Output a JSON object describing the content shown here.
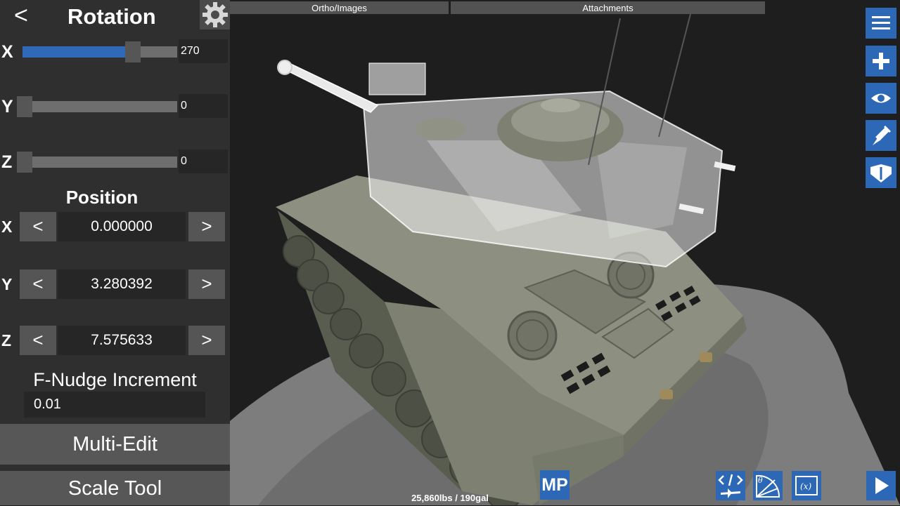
{
  "rotation_panel": {
    "back_label": "<",
    "title": "Rotation",
    "rows": [
      {
        "axis": "X",
        "value": "270",
        "fraction": 0.72
      },
      {
        "axis": "Y",
        "value": "0",
        "fraction": 0
      },
      {
        "axis": "Z",
        "value": "0",
        "fraction": 0
      }
    ]
  },
  "position_panel": {
    "title": "Position",
    "decrement_label": "<",
    "increment_label": ">",
    "rows": [
      {
        "axis": "X",
        "value": "0.000000"
      },
      {
        "axis": "Y",
        "value": "3.280392"
      },
      {
        "axis": "Z",
        "value": "7.575633"
      }
    ]
  },
  "nudge": {
    "label": "F-Nudge Increment",
    "value": "0.01"
  },
  "buttons": {
    "multi_edit": "Multi-Edit",
    "scale_tool": "Scale Tool",
    "mp": "MP"
  },
  "tabs": {
    "ortho_images": "Ortho/Images",
    "attachments": "Attachments"
  },
  "status": {
    "weight": "25,860lbs / 190gal"
  },
  "icons": {
    "gear": "gear-icon",
    "menu": "menu-icon",
    "add": "plus-icon",
    "view": "eye-icon",
    "paint": "paint-brush-icon",
    "wings": "wing-icon",
    "xml": "xml-code-icon",
    "flight_angle": "theta-gauge-icon",
    "variables": "variables-icon",
    "play": "play-icon"
  },
  "colors": {
    "accent": "#2c68b5",
    "panel": "#2f2f2f",
    "slider_fill": "#2f69b8"
  }
}
